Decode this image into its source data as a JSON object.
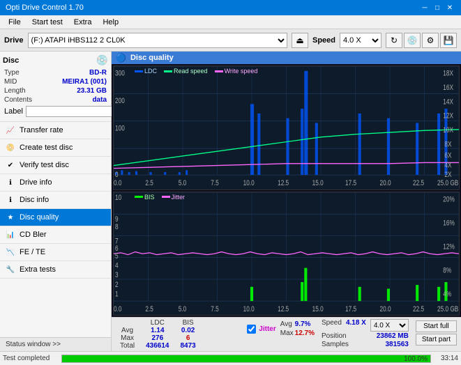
{
  "titlebar": {
    "title": "Opti Drive Control 1.70",
    "min_btn": "─",
    "max_btn": "□",
    "close_btn": "✕"
  },
  "menubar": {
    "items": [
      "File",
      "Start test",
      "Extra",
      "Help"
    ]
  },
  "drivebar": {
    "label": "Drive",
    "drive_value": "(F:)  ATAPI iHBS112  2 CL0K",
    "speed_label": "Speed",
    "speed_value": "4.0 X"
  },
  "left": {
    "disc_title": "Disc",
    "disc_fields": [
      {
        "label": "Type",
        "value": "BD-R"
      },
      {
        "label": "MID",
        "value": "MEIRA1 (001)"
      },
      {
        "label": "Length",
        "value": "23.31 GB"
      },
      {
        "label": "Contents",
        "value": "data"
      },
      {
        "label": "Label",
        "value": ""
      }
    ],
    "nav_items": [
      {
        "label": "Transfer rate",
        "active": false
      },
      {
        "label": "Create test disc",
        "active": false
      },
      {
        "label": "Verify test disc",
        "active": false
      },
      {
        "label": "Drive info",
        "active": false
      },
      {
        "label": "Disc info",
        "active": false
      },
      {
        "label": "Disc quality",
        "active": true
      },
      {
        "label": "CD Bler",
        "active": false
      },
      {
        "label": "FE / TE",
        "active": false
      },
      {
        "label": "Extra tests",
        "active": false
      }
    ],
    "status_btn": "Status window >>"
  },
  "quality_header": {
    "title": "Disc quality"
  },
  "chart_top": {
    "legend": [
      {
        "label": "LDC",
        "color": "#0055ff"
      },
      {
        "label": "Read speed",
        "color": "#00ff88"
      },
      {
        "label": "Write speed",
        "color": "#ff66ff"
      }
    ],
    "y_left": [
      "300",
      "200",
      "100",
      "0"
    ],
    "y_right": [
      "18X",
      "16X",
      "14X",
      "12X",
      "10X",
      "8X",
      "6X",
      "4X",
      "2X"
    ],
    "x_axis": [
      "0.0",
      "2.5",
      "5.0",
      "7.5",
      "10.0",
      "12.5",
      "15.0",
      "17.5",
      "20.0",
      "22.5",
      "25.0 GB"
    ]
  },
  "chart_bottom": {
    "legend": [
      {
        "label": "BIS",
        "color": "#00ff00"
      },
      {
        "label": "Jitter",
        "color": "#ff66ff"
      }
    ],
    "y_left": [
      "10",
      "9",
      "8",
      "7",
      "6",
      "5",
      "4",
      "3",
      "2",
      "1"
    ],
    "y_right": [
      "20%",
      "16%",
      "12%",
      "8%",
      "4%"
    ],
    "x_axis": [
      "0.0",
      "2.5",
      "5.0",
      "7.5",
      "10.0",
      "12.5",
      "15.0",
      "17.5",
      "20.0",
      "22.5",
      "25.0 GB"
    ]
  },
  "stats": {
    "headers": [
      "",
      "LDC",
      "BIS"
    ],
    "rows": [
      {
        "label": "Avg",
        "ldc": "1.14",
        "bis": "0.02"
      },
      {
        "label": "Max",
        "ldc": "276",
        "bis": "6",
        "ldc_red": false,
        "bis_red": true
      },
      {
        "label": "Total",
        "ldc": "436614",
        "bis": "8473"
      }
    ],
    "jitter_checked": true,
    "jitter_label": "Jitter",
    "jitter_avg": "9.7%",
    "jitter_max": "12.7%",
    "speed_label": "Speed",
    "speed_value": "4.18 X",
    "speed_select": "4.0 X",
    "position_label": "Position",
    "position_value": "23862 MB",
    "samples_label": "Samples",
    "samples_value": "381563",
    "btn_full": "Start full",
    "btn_part": "Start part"
  },
  "statusbar": {
    "status_text": "Test completed",
    "progress": 100,
    "progress_text": "100.0%",
    "time": "33:14"
  }
}
